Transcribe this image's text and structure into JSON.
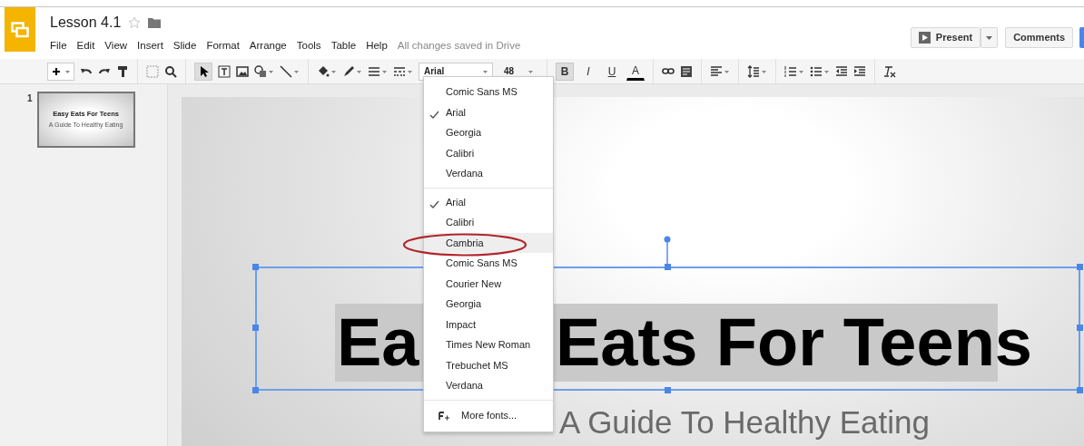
{
  "app": {
    "title": "Lesson 4.1",
    "starred": false,
    "menus": [
      "File",
      "Edit",
      "View",
      "Insert",
      "Slide",
      "Format",
      "Arrange",
      "Tools",
      "Table",
      "Help"
    ],
    "save_status": "All changes saved in Drive",
    "present_button": "Present",
    "comments_button": "Comments"
  },
  "toolbar": {
    "font": "Arial",
    "font_size": "48",
    "format_buttons": [
      {
        "label": "B",
        "active": true
      },
      {
        "label": "I",
        "active": false
      },
      {
        "label": "U",
        "active": false
      },
      {
        "label": "A",
        "active": false
      }
    ]
  },
  "filmstrip": [
    {
      "number": "1",
      "title": "Easy Eats For Teens",
      "subtitle": "A Guide To Healthy Eating",
      "selected": true
    }
  ],
  "slide": {
    "title_parts": [
      "Ea",
      "Eats For Teens"
    ],
    "subtitle": "A Guide To Healthy Eating"
  },
  "font_menu": {
    "sections": [
      [
        {
          "label": "Comic Sans MS",
          "checked": false,
          "highlighted": false
        },
        {
          "label": "Arial",
          "checked": true,
          "highlighted": false
        },
        {
          "label": "Georgia",
          "checked": false,
          "highlighted": false
        },
        {
          "label": "Calibri",
          "checked": false,
          "highlighted": false
        },
        {
          "label": "Verdana",
          "checked": false,
          "highlighted": false
        }
      ],
      [
        {
          "label": "Arial",
          "checked": true,
          "highlighted": false
        },
        {
          "label": "Calibri",
          "checked": false,
          "highlighted": false
        },
        {
          "label": "Cambria",
          "checked": false,
          "highlighted": true
        },
        {
          "label": "Comic Sans MS",
          "checked": false,
          "highlighted": false
        },
        {
          "label": "Courier New",
          "checked": false,
          "highlighted": false
        },
        {
          "label": "Georgia",
          "checked": false,
          "highlighted": false
        },
        {
          "label": "Impact",
          "checked": false,
          "highlighted": false
        },
        {
          "label": "Times New Roman",
          "checked": false,
          "highlighted": false
        },
        {
          "label": "Trebuchet MS",
          "checked": false,
          "highlighted": false
        },
        {
          "label": "Verdana",
          "checked": false,
          "highlighted": false
        }
      ]
    ],
    "more_fonts": "More fonts..."
  }
}
